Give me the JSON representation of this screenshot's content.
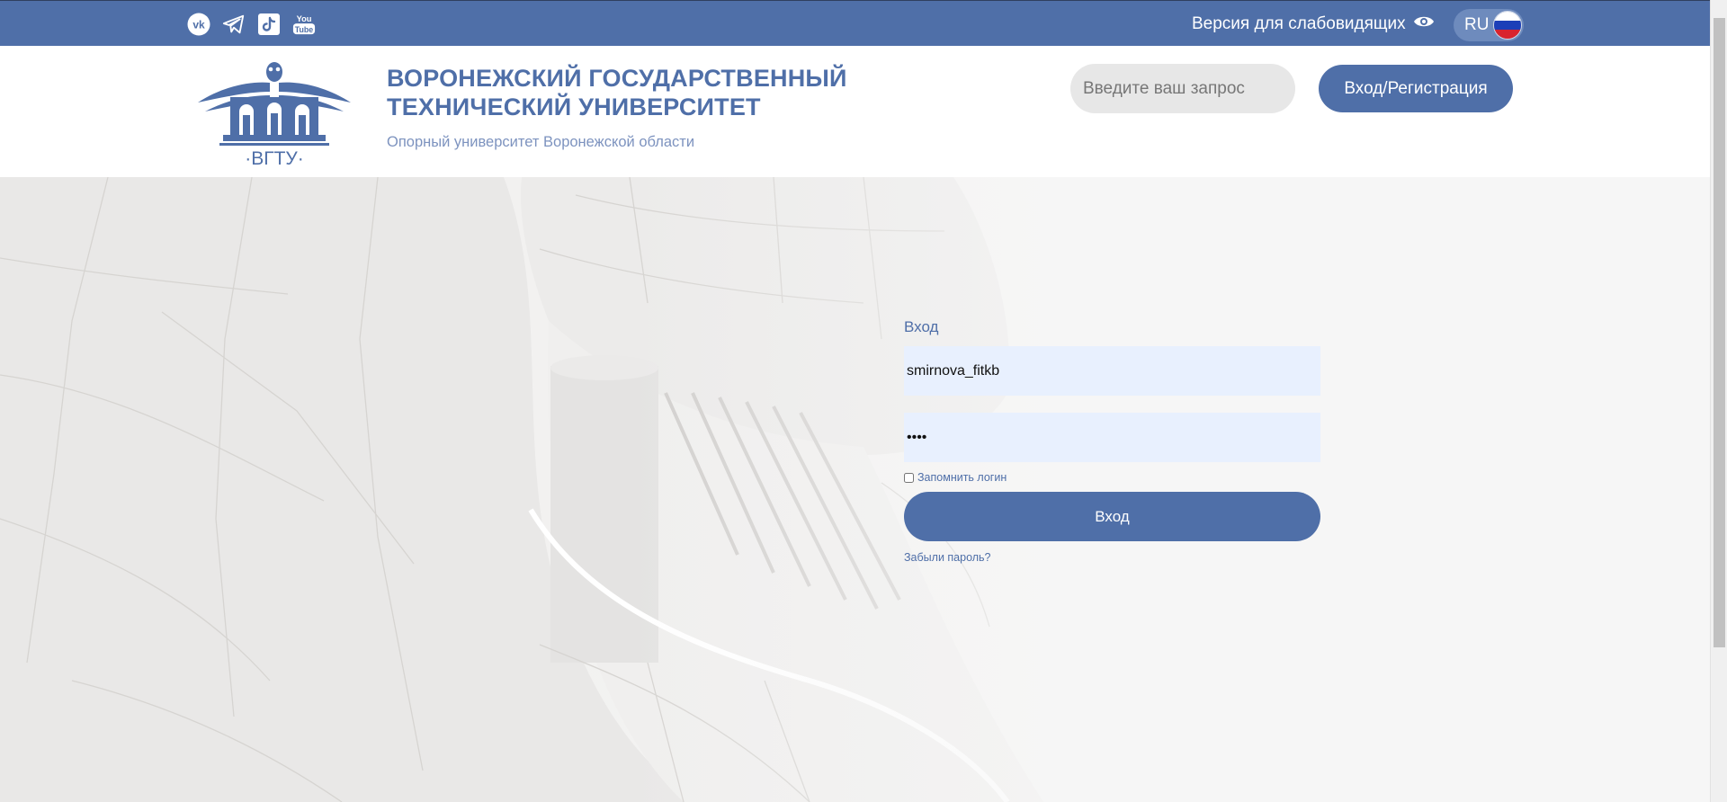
{
  "topbar": {
    "social": [
      {
        "name": "vk-icon",
        "glyph": "vk"
      },
      {
        "name": "telegram-icon"
      },
      {
        "name": "tiktok-icon"
      },
      {
        "name": "youtube-icon",
        "glyph_top": "You",
        "glyph_bottom": "Tube"
      }
    ],
    "vision_label": "Версия для слабовидящих",
    "lang_label": "RU"
  },
  "header": {
    "logo_text": "·ВГТУ·",
    "title_line1": "ВОРОНЕЖСКИЙ ГОСУДАРСТВЕННЫЙ",
    "title_line2": "ТЕХНИЧЕСКИЙ УНИВЕРСИТЕТ",
    "subtitle": "Опорный университет Воронежской области",
    "search_placeholder": "Введите ваш запрос",
    "login_register_label": "Вход/Регистрация"
  },
  "login_form": {
    "title": "Вход",
    "login_value": "smirnova_fitkb",
    "password_value": "••••",
    "remember_label": "Запомнить логин",
    "submit_label": "Вход",
    "forgot_label": "Забыли пароль?"
  },
  "colors": {
    "brand": "#4f6fa8",
    "input_bg": "#e8f0fe",
    "search_bg": "#e7e7e7"
  }
}
